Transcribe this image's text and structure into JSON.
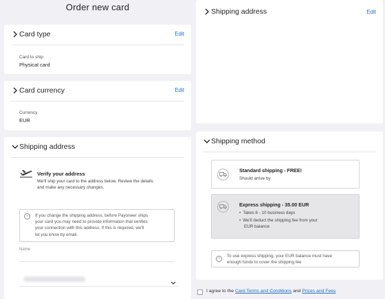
{
  "page": {
    "title": "Order new card"
  },
  "card_type": {
    "title": "Card type",
    "edit": "Edit",
    "field_label": "Card to ship",
    "field_value": "Physical card"
  },
  "card_currency": {
    "title": "Card currency",
    "edit": "Edit",
    "field_label": "Currency",
    "field_value": "EUR"
  },
  "shipping_address_left": {
    "title": "Shipping address",
    "verify_title": "Verify your address",
    "verify_line1": "We'll ship your card to the address below. Review the details",
    "verify_line2": "and make any necessary changes.",
    "notice_lines": [
      "If you change the shipping address, before Payoneer ships",
      "your card you may need to provide information that verifies",
      "your connection with this address. If this is required, we'll",
      "let you know by email."
    ],
    "name_label": "Name"
  },
  "shipping_address_right": {
    "title": "Shipping address",
    "edit": "Edit"
  },
  "shipping_method": {
    "title": "Shipping method",
    "standard": {
      "title": "Standard shipping - FREE!",
      "subtitle": "Should arrive by"
    },
    "express": {
      "title": "Express shipping - 35.00 EUR",
      "bullet1": "Takes 6 - 10 business days",
      "bullet2_line1": "We'll deduct the shipping fee from your",
      "bullet2_line2": "EUR balance"
    },
    "notice_line1": "To use express shipping, your EUR balance must have",
    "notice_line2": "enough funds to cover the shipping fee"
  },
  "agreement": {
    "prefix": "I agree to the",
    "terms_link": "Card Terms and Conditions",
    "middle": "and",
    "fees_link": "Prices and Fees"
  },
  "icons": {
    "collapse": "chevron-right-icon",
    "expand": "chevron-down-icon",
    "info": "info-icon",
    "plane": "plane-icon",
    "truck": "truck-icon"
  },
  "colors": {
    "link": "#1f6fc5",
    "selected_option": "#e6e6e9",
    "background": "#f1f1f5"
  }
}
